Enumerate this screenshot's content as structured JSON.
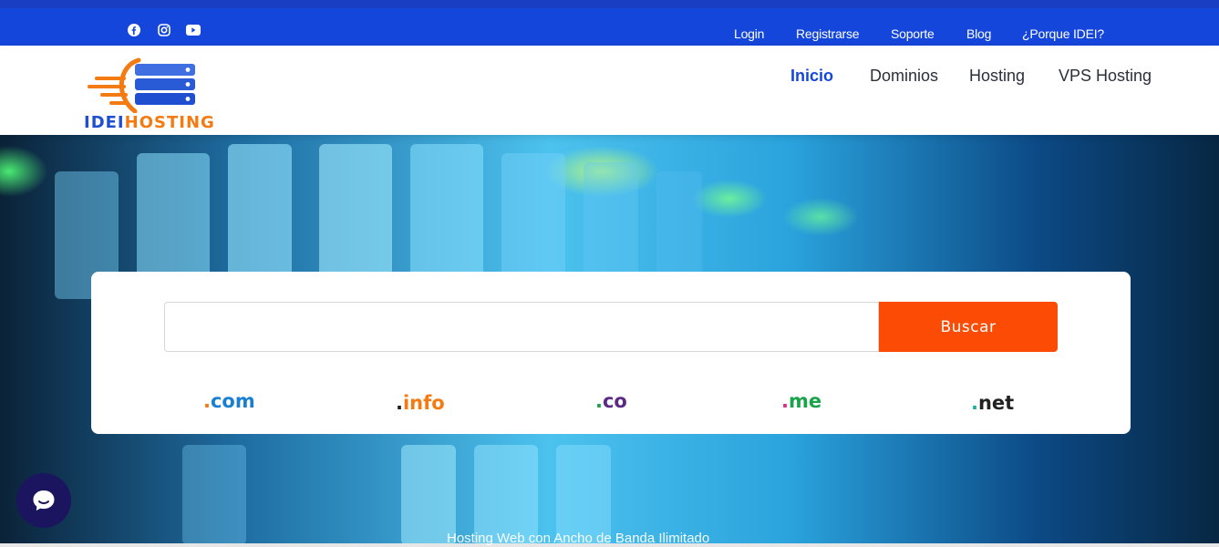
{
  "topbar": {
    "social_icons": [
      "facebook-icon",
      "instagram-icon",
      "youtube-icon"
    ],
    "links": [
      "Login",
      "Registrarse",
      "Soporte",
      "Blog",
      "¿Porque IDEI?"
    ]
  },
  "header": {
    "logo_text_left": "IDEI",
    "logo_text_right": "HOSTING",
    "nav": [
      "Inicio",
      "Dominios",
      "Hosting",
      "VPS Hosting"
    ],
    "active_nav": "Inicio"
  },
  "search": {
    "value": "",
    "button_label": "Buscar"
  },
  "tlds": [
    {
      "dot": ".",
      "name": "com",
      "dot_color": "#f47a12",
      "color": "#1a7fd1"
    },
    {
      "dot": ".",
      "name": "info",
      "dot_color": "#222222",
      "color": "#f47a12"
    },
    {
      "dot": ".",
      "name": "co",
      "dot_color": "#1aa34a",
      "color": "#5b2a86"
    },
    {
      "dot": ".",
      "name": "me",
      "dot_color": "#e02a8a",
      "color": "#1aa34a"
    },
    {
      "dot": ".",
      "name": "net",
      "dot_color": "#18b39c",
      "color": "#222222"
    }
  ],
  "hero": {
    "tagline": "Hosting Web con Ancho de Banda Ilimitado"
  },
  "colors": {
    "primary_blue": "#1546dc",
    "accent_orange": "#fc4b04",
    "chat_bubble": "#1b1560"
  }
}
